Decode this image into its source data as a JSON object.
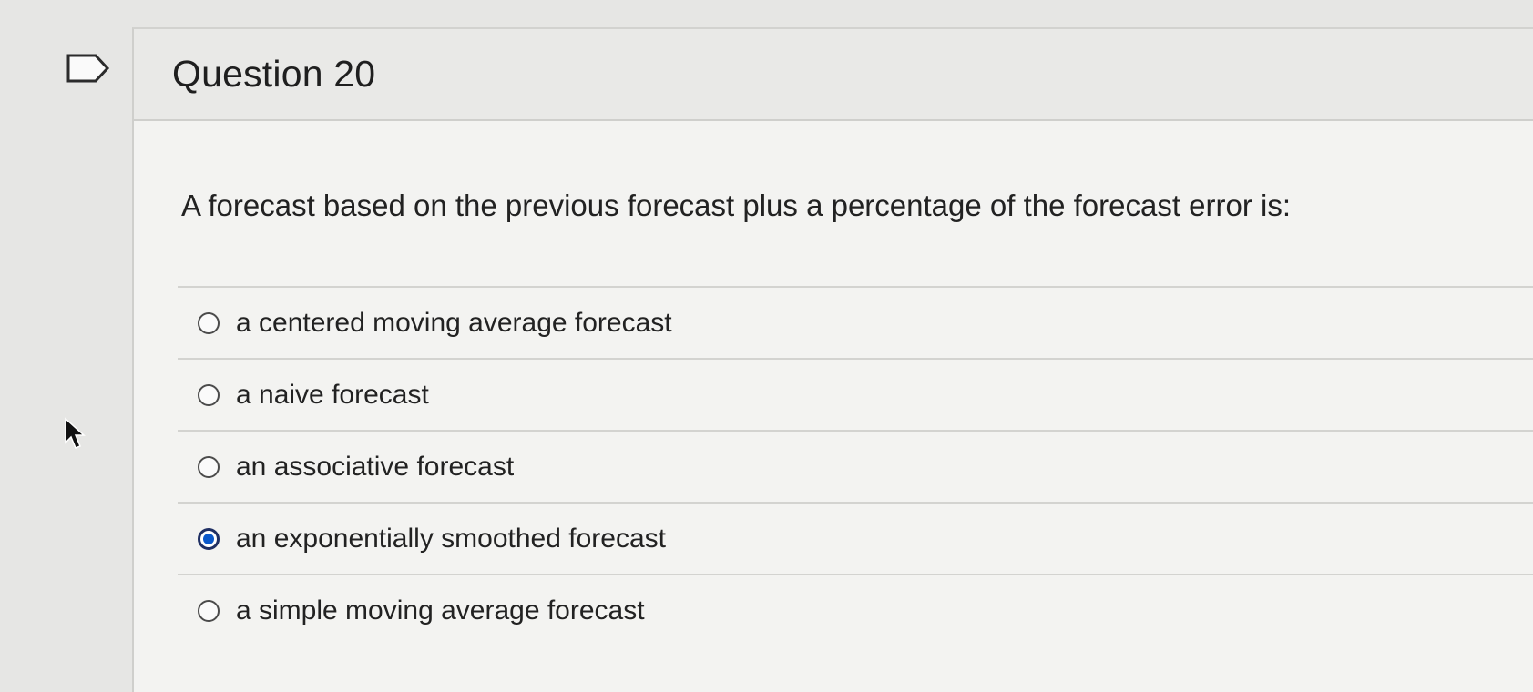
{
  "question": {
    "title": "Question 20",
    "text": "A forecast based on the previous forecast plus a percentage of the forecast error is:",
    "answers": [
      {
        "label": "a centered moving average forecast",
        "selected": false
      },
      {
        "label": "a naive forecast",
        "selected": false
      },
      {
        "label": "an associative forecast",
        "selected": false
      },
      {
        "label": "an exponentially smoothed forecast",
        "selected": true
      },
      {
        "label": "a simple moving average forecast",
        "selected": false
      }
    ]
  },
  "icons": {
    "flag": "flag-question-icon",
    "cursor": "mouse-pointer-icon"
  },
  "colors": {
    "selected_radio": "#0a58ca",
    "page_background": "#e6e6e4"
  }
}
